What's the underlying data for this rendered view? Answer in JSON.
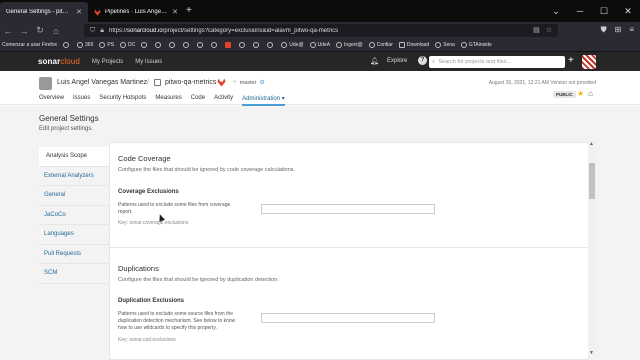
{
  "browser": {
    "tabs": [
      {
        "title": "General Settings - pitwo-qa-metr",
        "active": true
      },
      {
        "title": "Pipelines · Luis Angel Vanegas M",
        "active": false
      }
    ],
    "url": {
      "prefix": "https://",
      "host": "sonarcloud.io",
      "path": "/project/settings?category=exclusions&id=alavm_pitwo-qa-metrics"
    },
    "bookmarks": [
      {
        "label": "Comenzar a usar Firefox",
        "icon": "none"
      },
      {
        "label": "",
        "icon": "globe"
      },
      {
        "label": "365",
        "icon": "globe"
      },
      {
        "label": "PS",
        "icon": "globe"
      },
      {
        "label": "DC",
        "icon": "globe"
      },
      {
        "label": "",
        "icon": "globe"
      },
      {
        "label": "",
        "icon": "globe"
      },
      {
        "label": "",
        "icon": "globe"
      },
      {
        "label": "",
        "icon": "globe"
      },
      {
        "label": "",
        "icon": "globe"
      },
      {
        "label": "",
        "icon": "globe"
      },
      {
        "label": "",
        "icon": "gitlab"
      },
      {
        "label": "",
        "icon": "globe"
      },
      {
        "label": "",
        "icon": "globe"
      },
      {
        "label": "",
        "icon": "globe"
      },
      {
        "label": "Ude@",
        "icon": "globe"
      },
      {
        "label": "UdeA",
        "icon": "globe"
      },
      {
        "label": "Ingeni@",
        "icon": "globe"
      },
      {
        "label": "Confiar",
        "icon": "globe"
      },
      {
        "label": "Download",
        "icon": "ext"
      },
      {
        "label": "Sena",
        "icon": "globe"
      },
      {
        "label": "GTAinside",
        "icon": "globe"
      }
    ]
  },
  "sonar": {
    "logo_main": "sonar",
    "logo_accent": "cloud",
    "top_links": [
      "My Projects",
      "My Issues"
    ],
    "explore": "Explore",
    "search_placeholder": "Search for projects and files...",
    "plus": "+"
  },
  "project": {
    "org_name": "Luis Angel Vanegas Martinez",
    "separator": "/",
    "project_name": "pitwo-qa-metrics",
    "branch": "master",
    "meta": "August 26, 2021, 12:21 AM   Version not provided",
    "visibility": "PUBLIC",
    "nav": [
      {
        "label": "Overview",
        "active": false
      },
      {
        "label": "Issues",
        "active": false
      },
      {
        "label": "Security Hotspots",
        "active": false
      },
      {
        "label": "Measures",
        "active": false
      },
      {
        "label": "Code",
        "active": false
      },
      {
        "label": "Activity",
        "active": false
      },
      {
        "label": "Administration ▾",
        "active": true
      }
    ]
  },
  "page": {
    "title": "General Settings",
    "description": "Edit project settings."
  },
  "side_menu": [
    {
      "label": "Analysis Scope",
      "active": true
    },
    {
      "label": "External Analyzers",
      "active": false
    },
    {
      "label": "General",
      "active": false
    },
    {
      "label": "JaCoCo",
      "active": false
    },
    {
      "label": "Languages",
      "active": false
    },
    {
      "label": "Pull Requests",
      "active": false
    },
    {
      "label": "SCM",
      "active": false
    }
  ],
  "sections": {
    "code_coverage": {
      "title": "Code Coverage",
      "description": "Configure the files that should be ignored by code coverage calculations.",
      "setting_title": "Coverage Exclusions",
      "setting_description": "Patterns used to exclude some files from coverage report.",
      "setting_key": "Key: sonar.coverage.exclusions",
      "value": ""
    },
    "duplications": {
      "title": "Duplications",
      "description": "Configure the files that should be ignored by duplication detection.",
      "setting_title": "Duplication Exclusions",
      "setting_description": "Patterns used to exclude some source files from the duplication detection mechanism. See below to know how to use wildcards to specify this property.",
      "setting_key": "Key: sonar.cpd.exclusions",
      "value": ""
    }
  },
  "colors": {
    "accent": "#4b9fd5",
    "link": "#236a97",
    "sonar_orange": "#f3702a",
    "topbar": "#262626"
  }
}
